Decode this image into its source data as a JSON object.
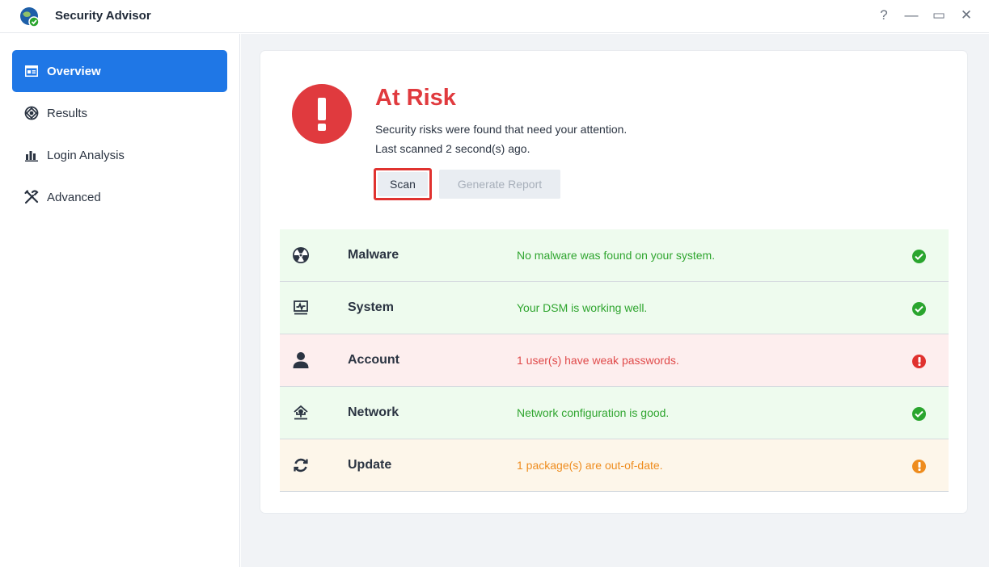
{
  "window": {
    "title": "Security Advisor",
    "controls": {
      "help": "?",
      "minimize": "—",
      "maximize": "▭",
      "close": "✕"
    }
  },
  "sidebar": {
    "items": [
      {
        "label": "Overview",
        "icon": "overview-icon",
        "active": true
      },
      {
        "label": "Results",
        "icon": "results-icon",
        "active": false
      },
      {
        "label": "Login Analysis",
        "icon": "bar-chart-icon",
        "active": false
      },
      {
        "label": "Advanced",
        "icon": "tools-icon",
        "active": false
      }
    ]
  },
  "overview": {
    "status_title": "At Risk",
    "description": "Security risks were found that need your attention.",
    "last_scanned": "Last scanned 2 second(s) ago.",
    "scan_button": "Scan",
    "report_button": "Generate Report"
  },
  "categories": [
    {
      "name": "Malware",
      "message": "No malware was found on your system.",
      "status": "ok",
      "icon": "radiation-icon"
    },
    {
      "name": "System",
      "message": "Your DSM is working well.",
      "status": "ok",
      "icon": "monitor-icon"
    },
    {
      "name": "Account",
      "message": "1 user(s) have weak passwords.",
      "status": "risk",
      "icon": "user-icon"
    },
    {
      "name": "Network",
      "message": "Network configuration is good.",
      "status": "ok",
      "icon": "network-icon"
    },
    {
      "name": "Update",
      "message": "1 package(s) are out-of-date.",
      "status": "warn",
      "icon": "refresh-icon"
    }
  ],
  "colors": {
    "accent": "#1f77e6",
    "risk": "#e03a3e",
    "ok": "#2aa52e",
    "warn": "#ee8c1e"
  }
}
